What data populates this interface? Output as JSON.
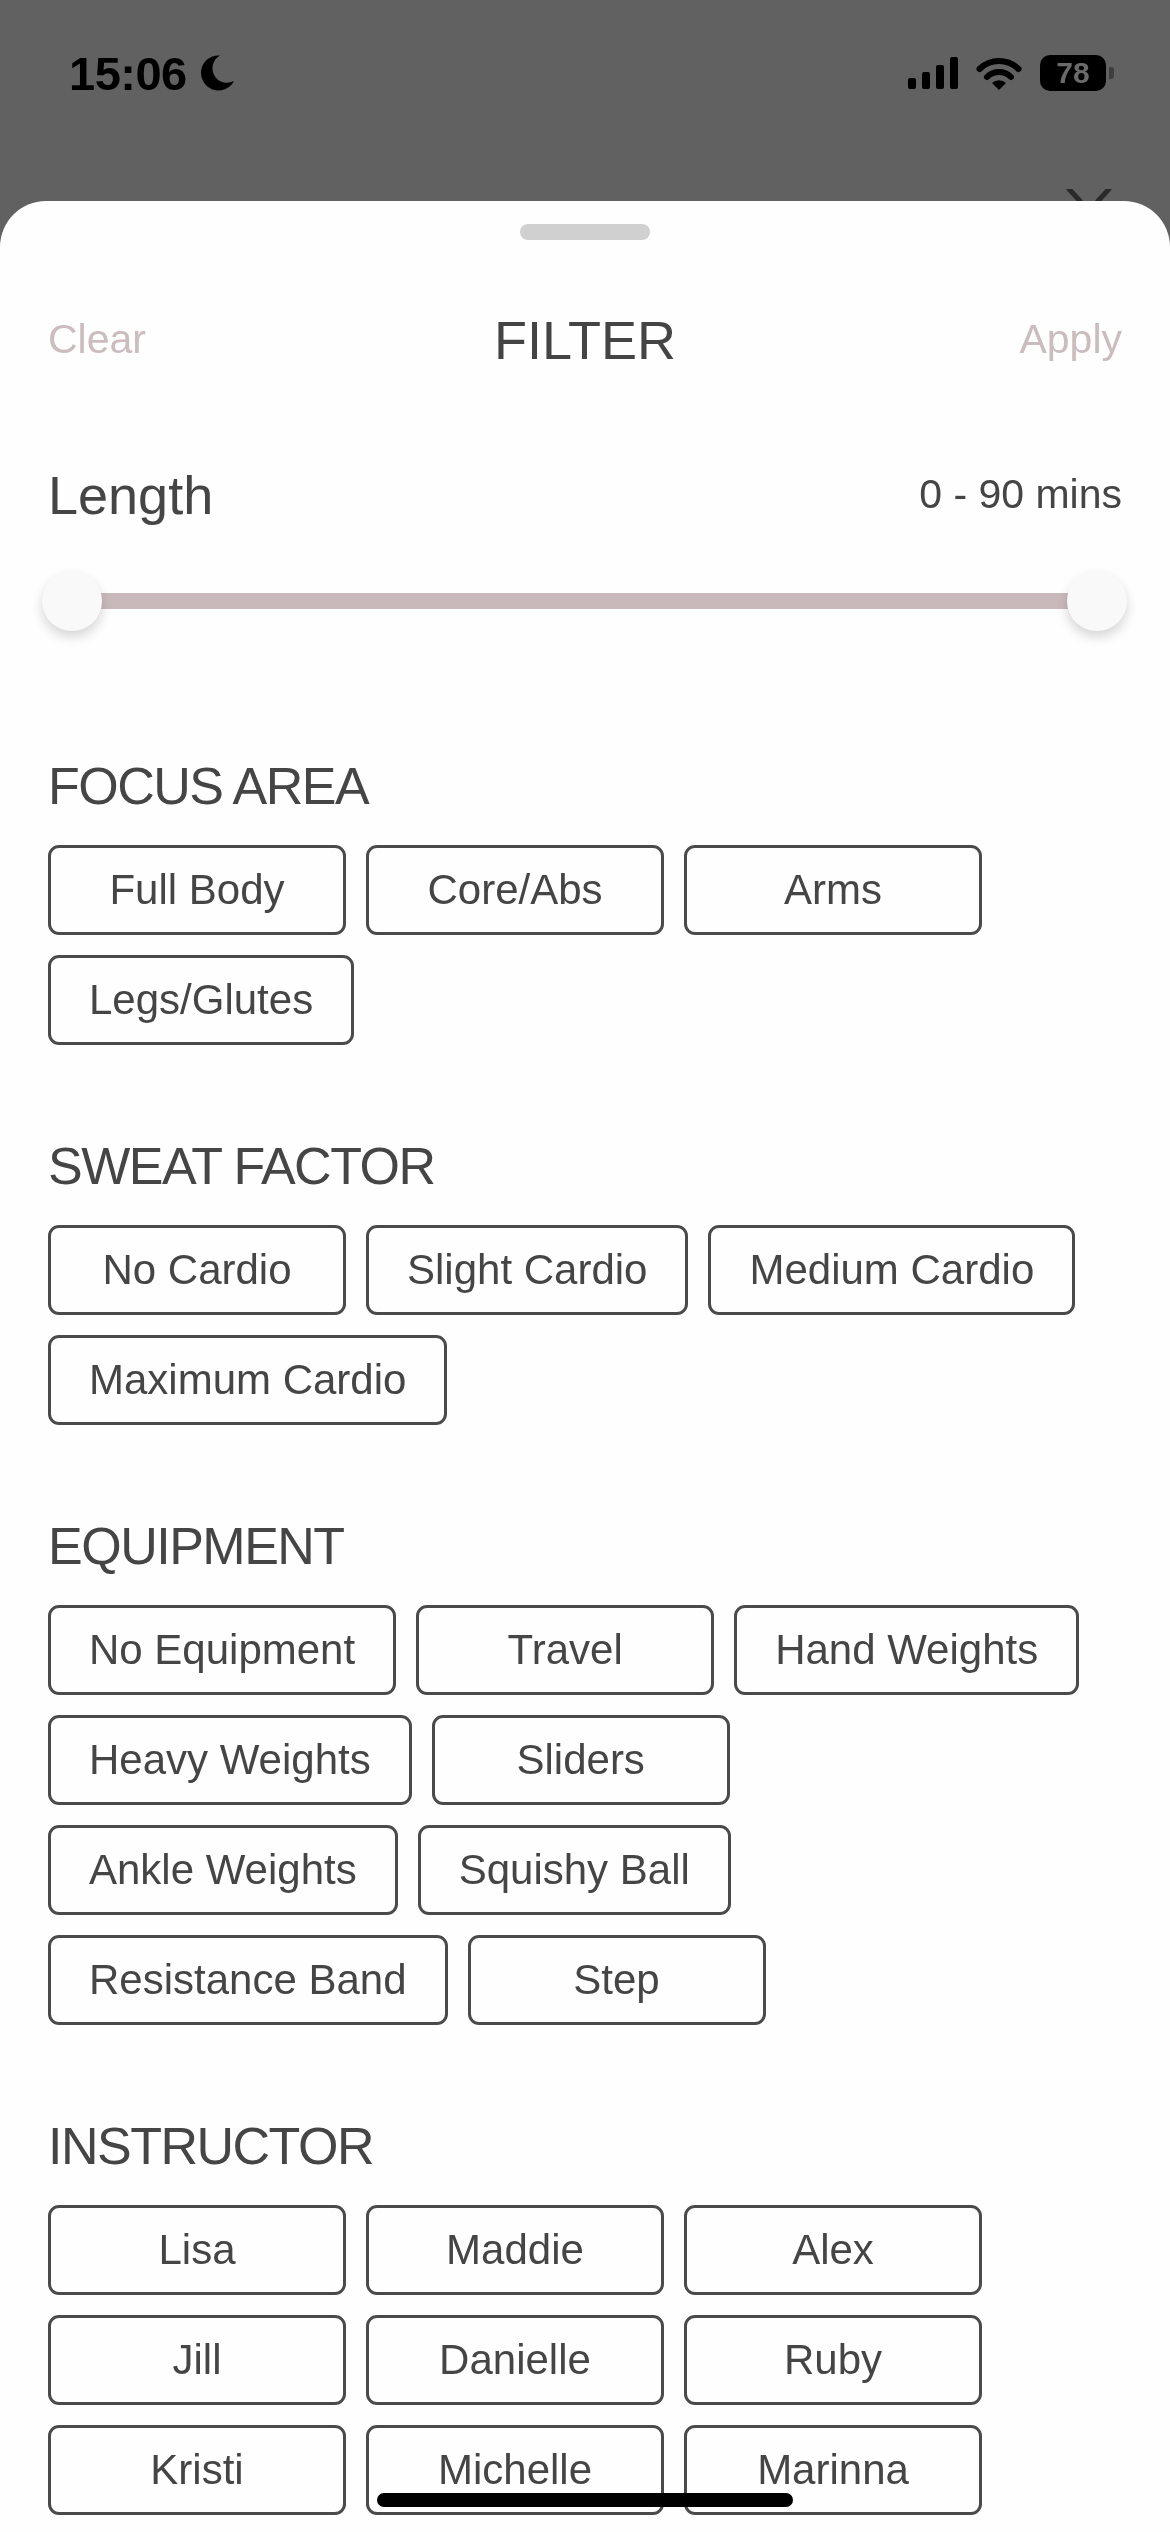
{
  "status_bar": {
    "time": "15:06",
    "battery": "78"
  },
  "sheet": {
    "clear_button": "Clear",
    "title": "FILTER",
    "apply_button": "Apply"
  },
  "length": {
    "label": "Length",
    "reading": "0 - 90 mins",
    "thumbs": [
      {
        "level": 0
      },
      {
        "level": 1
      }
    ]
  },
  "sections": [
    {
      "title": "FOCUS AREA",
      "rows": [
        [
          {
            "label": "Full Body",
            "selected": false
          },
          {
            "label": "Core/Abs",
            "selected": false
          },
          {
            "label": "Arms",
            "selected": false
          }
        ],
        [
          {
            "label": "Legs/Glutes",
            "selected": false
          }
        ]
      ]
    },
    {
      "title": "SWEAT FACTOR",
      "rows": [
        [
          {
            "label": "No Cardio",
            "selected": false
          },
          {
            "label": "Slight Cardio",
            "selected": false
          },
          {
            "label": "Medium Cardio",
            "selected": false
          }
        ],
        [
          {
            "label": "Maximum Cardio",
            "selected": false
          }
        ]
      ]
    },
    {
      "title": "EQUIPMENT",
      "rows": [
        [
          {
            "label": "No Equipment",
            "selected": false
          },
          {
            "label": "Travel",
            "selected": false
          },
          {
            "label": "Hand Weights",
            "selected": false
          }
        ],
        [
          {
            "label": "Heavy Weights",
            "selected": false
          },
          {
            "label": "Sliders",
            "selected": false
          }
        ],
        [
          {
            "label": "Ankle Weights",
            "selected": false
          },
          {
            "label": "Squishy Ball",
            "selected": false
          }
        ],
        [
          {
            "label": "Resistance Band",
            "selected": false
          },
          {
            "label": "Step",
            "selected": false
          }
        ]
      ]
    },
    {
      "title": "INSTRUCTOR",
      "rows": [
        [
          {
            "label": "Lisa",
            "selected": false
          },
          {
            "label": "Maddie",
            "selected": false
          },
          {
            "label": "Alex",
            "selected": false
          }
        ],
        [
          {
            "label": "Jill",
            "selected": false
          },
          {
            "label": "Danielle",
            "selected": false
          },
          {
            "label": "Ruby",
            "selected": false
          }
        ],
        [
          {
            "label": "Kristi",
            "selected": false
          },
          {
            "label": "Michelle",
            "selected": false
          },
          {
            "label": "Marinna",
            "selected": false
          }
        ]
      ]
    }
  ]
}
